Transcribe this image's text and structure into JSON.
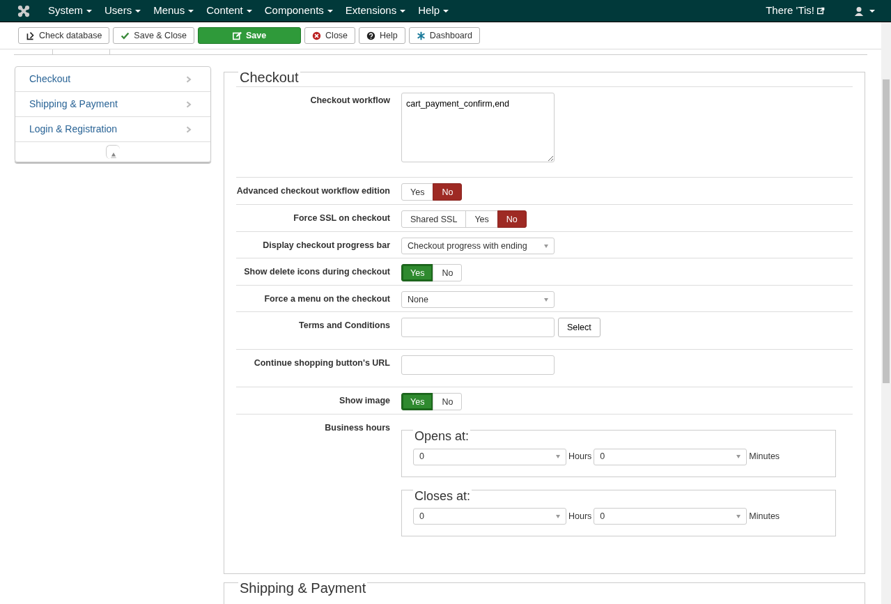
{
  "navbar": {
    "menus": [
      "System",
      "Users",
      "Menus",
      "Content",
      "Components",
      "Extensions",
      "Help"
    ],
    "site_link": "There 'Tis!"
  },
  "toolbar": [
    {
      "label": "Check database",
      "kind": "database",
      "primary": false
    },
    {
      "label": "Save & Close",
      "kind": "check",
      "primary": false
    },
    {
      "label": "Save",
      "kind": "edit",
      "primary": true
    },
    {
      "label": "Close",
      "kind": "close",
      "primary": false
    },
    {
      "label": "Help",
      "kind": "help",
      "primary": false
    },
    {
      "label": "Dashboard",
      "kind": "dashboard",
      "primary": false
    }
  ],
  "sidebar": {
    "items": [
      {
        "label": "Checkout"
      },
      {
        "label": "Shipping & Payment"
      },
      {
        "label": "Login & Registration"
      }
    ]
  },
  "sections": [
    {
      "title": "Checkout",
      "fields": [
        {
          "label": "Checkout workflow",
          "kind": "textarea",
          "value": "cart_payment_confirm,end"
        },
        {
          "label": "Advanced checkout workflow edition",
          "kind": "toggle",
          "options": [
            {
              "label": "Yes",
              "kind": "positive",
              "selected": false
            },
            {
              "label": "No",
              "kind": "negative",
              "selected": true
            }
          ]
        },
        {
          "label": "Force SSL on checkout",
          "kind": "toggle",
          "options": [
            {
              "label": "Shared SSL",
              "kind": "neutral",
              "selected": false
            },
            {
              "label": "Yes",
              "kind": "positive",
              "selected": false
            },
            {
              "label": "No",
              "kind": "negative",
              "selected": true
            }
          ]
        },
        {
          "label": "Display checkout progress bar",
          "kind": "select",
          "value": "Checkout progress with ending"
        },
        {
          "label": "Show delete icons during checkout",
          "kind": "toggle",
          "options": [
            {
              "label": "Yes",
              "kind": "positive",
              "selected": true
            },
            {
              "label": "No",
              "kind": "negative",
              "selected": false
            }
          ]
        },
        {
          "label": "Force a menu on the checkout",
          "kind": "select",
          "value": "None"
        },
        {
          "label": "Terms and Conditions",
          "kind": "picker",
          "button": "Select"
        },
        {
          "label": "Continue shopping button's URL",
          "kind": "text"
        },
        {
          "label": "Show image",
          "kind": "toggle",
          "options": [
            {
              "label": "Yes",
              "kind": "positive",
              "selected": true
            },
            {
              "label": "No",
              "kind": "negative",
              "selected": false
            }
          ]
        },
        {
          "label": "Business hours",
          "kind": "hours",
          "groups": [
            {
              "legend": "Opens at:",
              "hour": "0",
              "hours_label": "Hours",
              "minute": "0",
              "minutes_label": "Minutes"
            },
            {
              "legend": "Closes at:",
              "hour": "0",
              "hours_label": "Hours",
              "minute": "0",
              "minutes_label": "Minutes"
            }
          ]
        }
      ]
    },
    {
      "title": "Shipping & Payment"
    }
  ]
}
